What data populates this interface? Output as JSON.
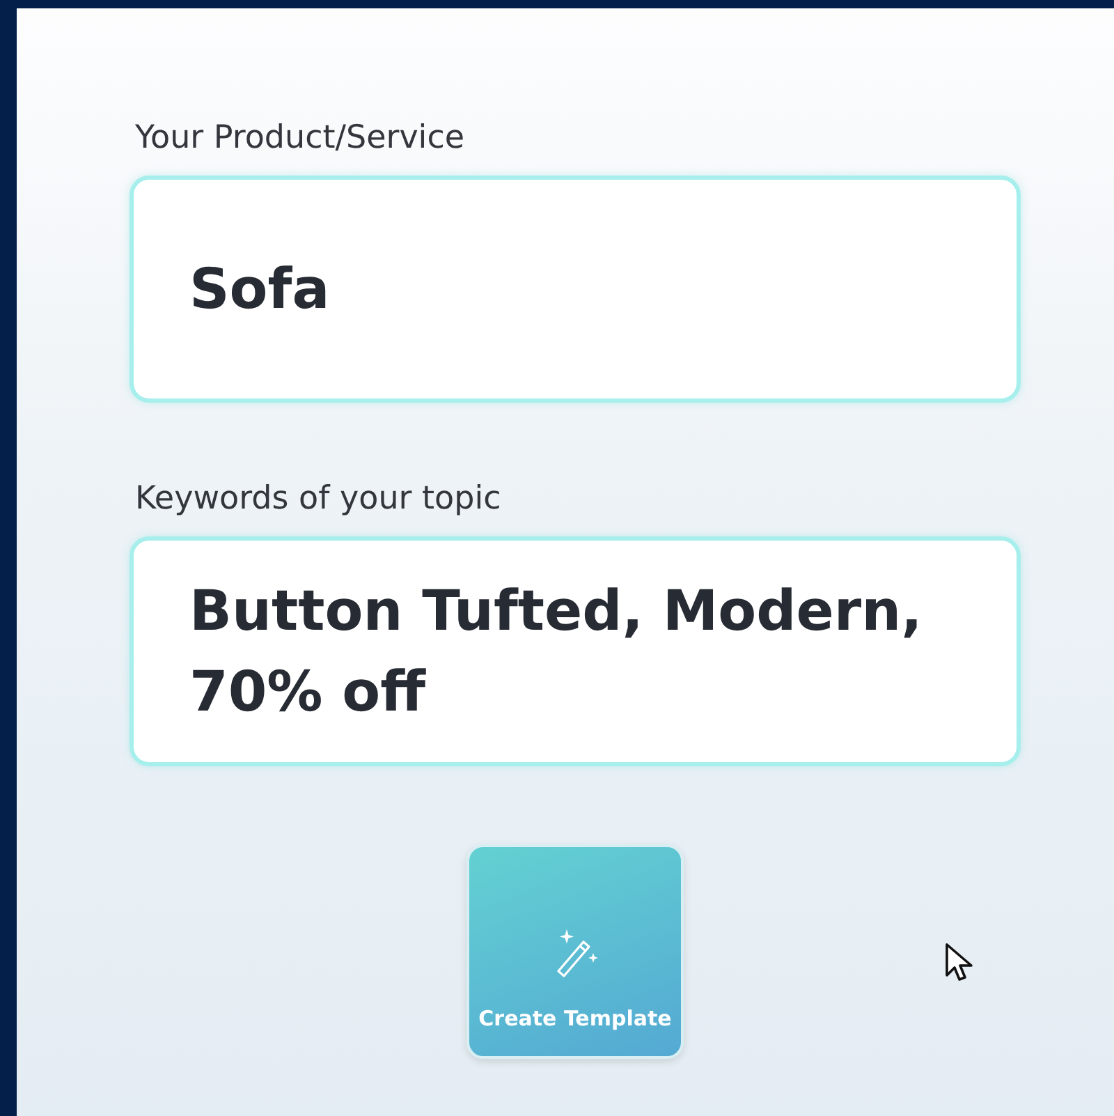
{
  "fields": [
    {
      "label": "Your Product/Service",
      "value": "Sofa"
    },
    {
      "label": "Keywords of your topic",
      "value": "Button Tufted, Modern, 70% off"
    }
  ],
  "button": {
    "label": "Create Template"
  }
}
